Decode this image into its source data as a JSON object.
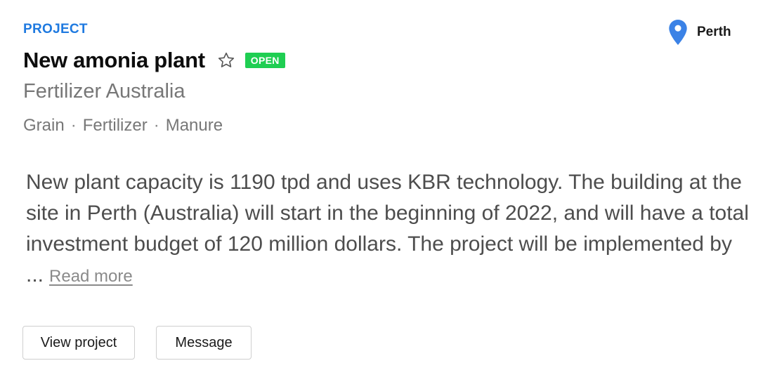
{
  "card": {
    "kind_label": "PROJECT",
    "title": "New amonia plant",
    "status_badge": "OPEN",
    "company": "Fertilizer Australia",
    "tags": [
      "Grain",
      "Fertilizer",
      "Manure"
    ],
    "tag_separator": "·",
    "location": "Perth",
    "description": "New plant capacity is 1190 tpd and uses KBR technology. The building at the site in Perth (Australia) will start in the beginning of 2022, and will have a total investment budget of 120 million dollars. The project will be implemented by ...",
    "read_more_label": "Read more",
    "buttons": {
      "view_project": "View project",
      "message": "Message"
    }
  },
  "icons": {
    "location": "map-pin-icon",
    "favorite": "star-outline-icon"
  },
  "colors": {
    "accent_blue": "#1f7ae0",
    "pin_blue": "#3b82e6",
    "badge_green": "#1fce52",
    "muted_text": "#777777"
  }
}
